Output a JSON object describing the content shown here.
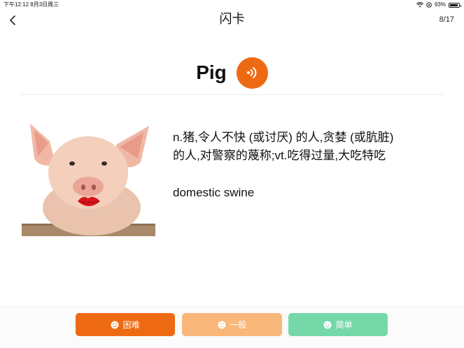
{
  "status_bar": {
    "time_date": "下午12:12   8月3日周三",
    "battery_percent": "93%",
    "battery_level": 0.93
  },
  "nav": {
    "title": "闪卡",
    "page_count": "8/17"
  },
  "card": {
    "word": "Pig",
    "meaning_line1": "n.猪,令人不快 (或讨厌) 的人,贪婪 (或肮脏)",
    "meaning_line2": "的人,对警察的蔑称;vt.吃得过量,大吃特吃",
    "example": "domestic swine"
  },
  "buttons": {
    "hard": {
      "label": "困难",
      "color": "#ee6a12"
    },
    "normal": {
      "label": "一般",
      "color": "#f9b779"
    },
    "easy": {
      "label": "简单",
      "color": "#75d8a8"
    }
  },
  "colors": {
    "accent": "#ee6a12"
  }
}
